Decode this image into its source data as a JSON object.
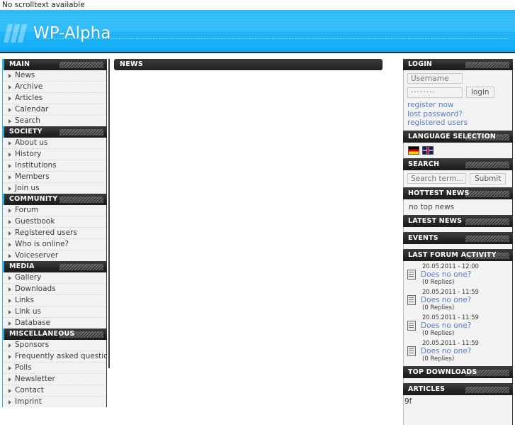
{
  "scrolltext": "No scrolltext available",
  "header": {
    "site_title": "WP-Alpha",
    "logo_icon": "three-slanted-bars-icon"
  },
  "left_sidebar": {
    "blocks": [
      {
        "title": "MAIN",
        "items": [
          "News",
          "Archive",
          "Articles",
          "Calendar",
          "Search"
        ]
      },
      {
        "title": "SOCIETY",
        "items": [
          "About us",
          "History",
          "Institutions",
          "Members",
          "Join us"
        ]
      },
      {
        "title": "COMMUNITY",
        "items": [
          "Forum",
          "Guestbook",
          "Registered users",
          "Who is online?",
          "Voiceserver"
        ]
      },
      {
        "title": "MEDIA",
        "items": [
          "Gallery",
          "Downloads",
          "Links",
          "Link us",
          "Database"
        ]
      },
      {
        "title": "MISCELLANEOUS",
        "items": [
          "Sponsors",
          "Frequently asked questions",
          "Polls",
          "Newsletter",
          "Contact",
          "Imprint"
        ]
      }
    ]
  },
  "main": {
    "news_title": "NEWS",
    "news_body": ""
  },
  "right_sidebar": {
    "login": {
      "title": "LOGIN",
      "username_placeholder": "Username",
      "username_value": "",
      "password_value": "········",
      "login_button": "login",
      "links": [
        "register now",
        "lost password?",
        "registered users"
      ]
    },
    "language": {
      "title": "LANGUAGE SELECTION",
      "flags": [
        {
          "name": "german-flag-icon",
          "code": "de"
        },
        {
          "name": "english-flag-icon",
          "code": "uk"
        }
      ]
    },
    "search": {
      "title": "SEARCH",
      "placeholder": "Search term...",
      "value": "",
      "submit_label": "Submit"
    },
    "hottest_news": {
      "title": "HOTTEST NEWS",
      "empty_text": "no top news"
    },
    "latest_news": {
      "title": "LATEST NEWS",
      "empty_text": ""
    },
    "events": {
      "title": "EVENTS",
      "empty_text": ""
    },
    "forum_activity": {
      "title": "LAST FORUM ACTIVITY",
      "entries": [
        {
          "date": "20.05.2011 - 12:00",
          "title": "Does no one?",
          "replies": "(0 Replies)"
        },
        {
          "date": "20.05.2011 - 11:59",
          "title": "Does no one?",
          "replies": "(0 Replies)"
        },
        {
          "date": "20.05.2011 - 11:59",
          "title": "Does no one?",
          "replies": "(0 Replies)"
        },
        {
          "date": "20.05.2011 - 11:59",
          "title": "Does no one?",
          "replies": "(0 Replies)"
        }
      ]
    },
    "top_downloads": {
      "title": "TOP DOWNLOADS",
      "empty_text": ""
    },
    "articles": {
      "title": "ARTICLES",
      "text": "9f"
    }
  },
  "colors": {
    "accent": "#2bb3f0",
    "header_bg": "#31bcf8",
    "panel_header": "#2b2b2b",
    "link": "#5a7fc4"
  }
}
